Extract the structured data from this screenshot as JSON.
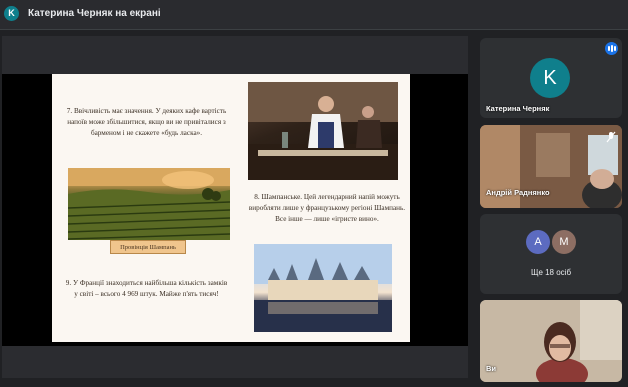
{
  "header": {
    "avatar_letter": "K",
    "title": "Катерина Черняк на екрані"
  },
  "slide": {
    "item7": "7. Ввічливість має значення. У деяких кафе вартість напоїв може збільшитися, якщо ви не привіталися з барменом і не скажете «будь ласка».",
    "item8": "8. Шампанське. Цей легендарний напій можуть виробляти лише у французькому регіоні Шампань. Все інше — лише «ігристе вино».",
    "item9": "9. У Франції знаходиться найбільша кількість замків у світі – всього 4 969 штук. Майже п'ять тисяч!",
    "caption": "Провінція Шампань"
  },
  "participants": [
    {
      "name": "Катерина Черняк",
      "letter": "K",
      "color": "#0f7f8c"
    },
    {
      "name": "Андрій Раднянко"
    },
    {
      "more_label": "Ще 18 осіб",
      "avatars": [
        {
          "letter": "A",
          "color": "#5c6bc0"
        },
        {
          "letter": "M",
          "color": "#8d6e63"
        }
      ]
    },
    {
      "name": "Ви"
    }
  ]
}
